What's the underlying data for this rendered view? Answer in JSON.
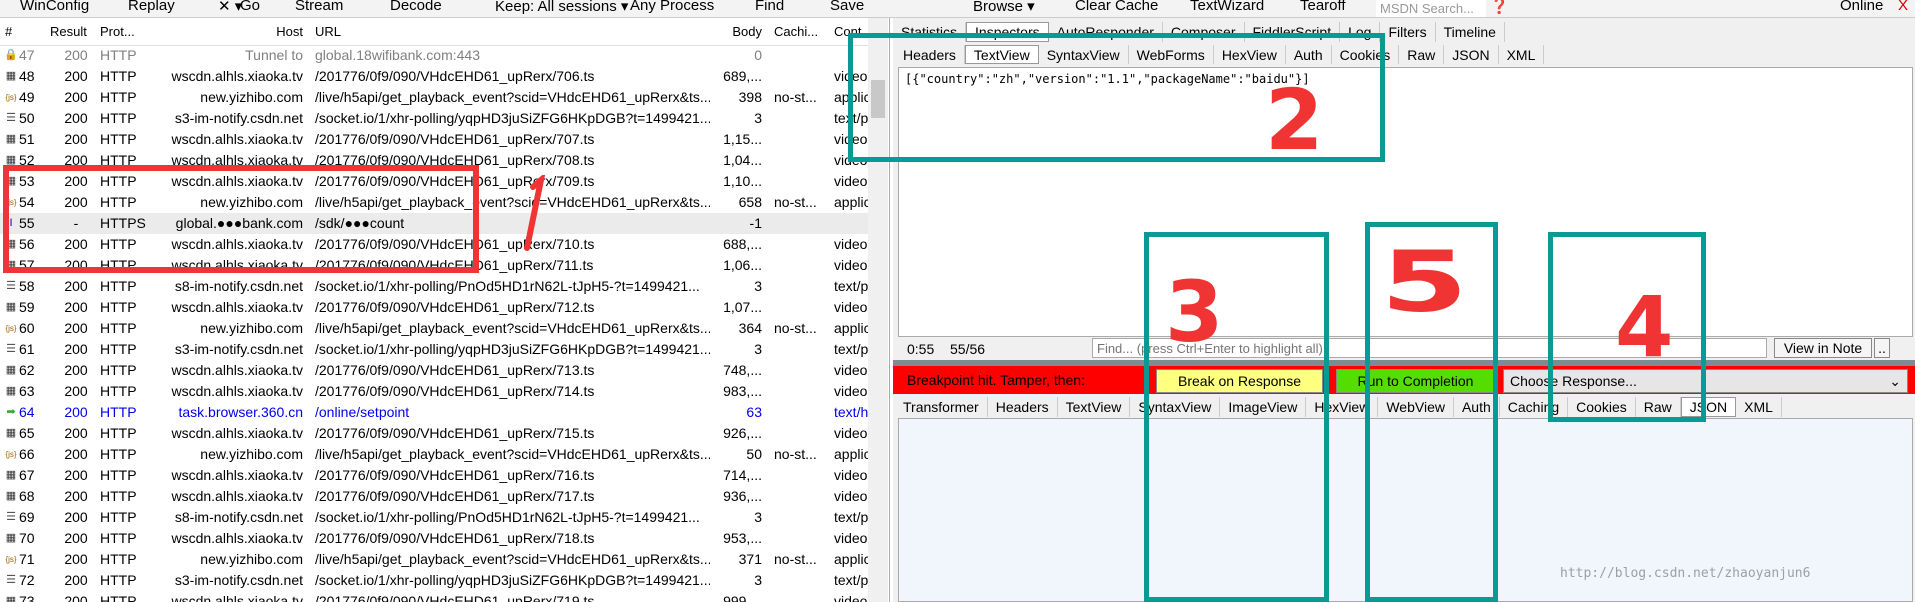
{
  "toolbar": {
    "left": [
      "WinConfig",
      "Replay",
      "✕ ▾",
      "Go",
      "Stream",
      "Decode",
      "Keep: All sessions ▾",
      "Any Process",
      "Find",
      "Save"
    ],
    "right": [
      "Browse ▾",
      "Clear Cache",
      "TextWizard",
      "Tearoff"
    ],
    "search_placeholder": "MSDN Search...",
    "online": "Online",
    "close": "X"
  },
  "columns": {
    "num": "#",
    "result": "Result",
    "protocol": "Prot...",
    "host": "Host",
    "url": "URL",
    "body": "Body",
    "caching": "Cachi...",
    "content": "Cont..."
  },
  "sessions": [
    {
      "icon": "lock-icon",
      "n": "47",
      "r": "200",
      "p": "HTTP",
      "h": "Tunnel to",
      "u": "global.18wifibank.com:443",
      "b": "0",
      "c": "",
      "t": "",
      "style": "dim"
    },
    {
      "icon": "video-icon",
      "n": "48",
      "r": "200",
      "p": "HTTP",
      "h": "wscdn.alhls.xiaoka.tv",
      "u": "/201776/0f9/090/VHdcEHD61_upRerx/706.ts",
      "b": "689,...",
      "c": "",
      "t": "video"
    },
    {
      "icon": "json-icon",
      "n": "49",
      "r": "200",
      "p": "HTTP",
      "h": "new.yizhibo.com",
      "u": "/live/h5api/get_playback_event?scid=VHdcEHD61_upRerx&ts...",
      "b": "398",
      "c": "no-st...",
      "t": "applic"
    },
    {
      "icon": "text-icon",
      "n": "50",
      "r": "200",
      "p": "HTTP",
      "h": "s3-im-notify.csdn.net",
      "u": "/socket.io/1/xhr-polling/yqpHD3juSiZFG6HKpDGB?t=1499421...",
      "b": "3",
      "c": "",
      "t": "text/p"
    },
    {
      "icon": "video-icon",
      "n": "51",
      "r": "200",
      "p": "HTTP",
      "h": "wscdn.alhls.xiaoka.tv",
      "u": "/201776/0f9/090/VHdcEHD61_upRerx/707.ts",
      "b": "1,15...",
      "c": "",
      "t": "video"
    },
    {
      "icon": "video-icon",
      "n": "52",
      "r": "200",
      "p": "HTTP",
      "h": "wscdn.alhls.xiaoka.tv",
      "u": "/201776/0f9/090/VHdcEHD61_upRerx/708.ts",
      "b": "1,04...",
      "c": "",
      "t": "video"
    },
    {
      "icon": "video-icon",
      "n": "53",
      "r": "200",
      "p": "HTTP",
      "h": "wscdn.alhls.xiaoka.tv",
      "u": "/201776/0f9/090/VHdcEHD61_upRerx/709.ts",
      "b": "1,10...",
      "c": "",
      "t": "video"
    },
    {
      "icon": "json-icon",
      "n": "54",
      "r": "200",
      "p": "HTTP",
      "h": "new.yizhibo.com",
      "u": "/live/h5api/get_playback_event?scid=VHdcEHD61_upRerx&ts...",
      "b": "658",
      "c": "no-st...",
      "t": "applic"
    },
    {
      "icon": "breakpoint-icon",
      "n": "55",
      "r": "-",
      "p": "HTTPS",
      "h": "global.●●●bank.com",
      "u": "/sdk/●●●count",
      "b": "-1",
      "c": "",
      "t": "",
      "style": "sel"
    },
    {
      "icon": "video-icon",
      "n": "56",
      "r": "200",
      "p": "HTTP",
      "h": "wscdn.alhls.xiaoka.tv",
      "u": "/201776/0f9/090/VHdcEHD61_upRerx/710.ts",
      "b": "688,...",
      "c": "",
      "t": "video"
    },
    {
      "icon": "video-icon",
      "n": "57",
      "r": "200",
      "p": "HTTP",
      "h": "wscdn.alhls.xiaoka.tv",
      "u": "/201776/0f9/090/VHdcEHD61_upRerx/711.ts",
      "b": "1,06...",
      "c": "",
      "t": "video"
    },
    {
      "icon": "text-icon",
      "n": "58",
      "r": "200",
      "p": "HTTP",
      "h": "s8-im-notify.csdn.net",
      "u": "/socket.io/1/xhr-polling/PnOd5HD1rN62L-tJpH5-?t=1499421...",
      "b": "3",
      "c": "",
      "t": "text/p"
    },
    {
      "icon": "video-icon",
      "n": "59",
      "r": "200",
      "p": "HTTP",
      "h": "wscdn.alhls.xiaoka.tv",
      "u": "/201776/0f9/090/VHdcEHD61_upRerx/712.ts",
      "b": "1,07...",
      "c": "",
      "t": "video"
    },
    {
      "icon": "json-icon",
      "n": "60",
      "r": "200",
      "p": "HTTP",
      "h": "new.yizhibo.com",
      "u": "/live/h5api/get_playback_event?scid=VHdcEHD61_upRerx&ts...",
      "b": "364",
      "c": "no-st...",
      "t": "applic"
    },
    {
      "icon": "text-icon",
      "n": "61",
      "r": "200",
      "p": "HTTP",
      "h": "s3-im-notify.csdn.net",
      "u": "/socket.io/1/xhr-polling/yqpHD3juSiZFG6HKpDGB?t=1499421...",
      "b": "3",
      "c": "",
      "t": "text/p"
    },
    {
      "icon": "video-icon",
      "n": "62",
      "r": "200",
      "p": "HTTP",
      "h": "wscdn.alhls.xiaoka.tv",
      "u": "/201776/0f9/090/VHdcEHD61_upRerx/713.ts",
      "b": "748,...",
      "c": "",
      "t": "video"
    },
    {
      "icon": "video-icon",
      "n": "63",
      "r": "200",
      "p": "HTTP",
      "h": "wscdn.alhls.xiaoka.tv",
      "u": "/201776/0f9/090/VHdcEHD61_upRerx/714.ts",
      "b": "983,...",
      "c": "",
      "t": "video"
    },
    {
      "icon": "arrow-icon",
      "n": "64",
      "r": "200",
      "p": "HTTP",
      "h": "task.browser.360.cn",
      "u": "/online/setpoint",
      "b": "63",
      "c": "",
      "t": "text/h",
      "style": "blue"
    },
    {
      "icon": "video-icon",
      "n": "65",
      "r": "200",
      "p": "HTTP",
      "h": "wscdn.alhls.xiaoka.tv",
      "u": "/201776/0f9/090/VHdcEHD61_upRerx/715.ts",
      "b": "926,...",
      "c": "",
      "t": "video"
    },
    {
      "icon": "json-icon",
      "n": "66",
      "r": "200",
      "p": "HTTP",
      "h": "new.yizhibo.com",
      "u": "/live/h5api/get_playback_event?scid=VHdcEHD61_upRerx&ts...",
      "b": "50",
      "c": "no-st...",
      "t": "applic"
    },
    {
      "icon": "video-icon",
      "n": "67",
      "r": "200",
      "p": "HTTP",
      "h": "wscdn.alhls.xiaoka.tv",
      "u": "/201776/0f9/090/VHdcEHD61_upRerx/716.ts",
      "b": "714,...",
      "c": "",
      "t": "video"
    },
    {
      "icon": "video-icon",
      "n": "68",
      "r": "200",
      "p": "HTTP",
      "h": "wscdn.alhls.xiaoka.tv",
      "u": "/201776/0f9/090/VHdcEHD61_upRerx/717.ts",
      "b": "936,...",
      "c": "",
      "t": "video"
    },
    {
      "icon": "text-icon",
      "n": "69",
      "r": "200",
      "p": "HTTP",
      "h": "s8-im-notify.csdn.net",
      "u": "/socket.io/1/xhr-polling/PnOd5HD1rN62L-tJpH5-?t=1499421...",
      "b": "3",
      "c": "",
      "t": "text/p"
    },
    {
      "icon": "video-icon",
      "n": "70",
      "r": "200",
      "p": "HTTP",
      "h": "wscdn.alhls.xiaoka.tv",
      "u": "/201776/0f9/090/VHdcEHD61_upRerx/718.ts",
      "b": "953,...",
      "c": "",
      "t": "video"
    },
    {
      "icon": "json-icon",
      "n": "71",
      "r": "200",
      "p": "HTTP",
      "h": "new.yizhibo.com",
      "u": "/live/h5api/get_playback_event?scid=VHdcEHD61_upRerx&ts...",
      "b": "371",
      "c": "no-st...",
      "t": "applic"
    },
    {
      "icon": "text-icon",
      "n": "72",
      "r": "200",
      "p": "HTTP",
      "h": "s3-im-notify.csdn.net",
      "u": "/socket.io/1/xhr-polling/yqpHD3juSiZFG6HKpDGB?t=1499421...",
      "b": "3",
      "c": "",
      "t": "text/p"
    },
    {
      "icon": "video-icon",
      "n": "73",
      "r": "200",
      "p": "HTTP",
      "h": "wscdn.alhls.xiaoka.tv",
      "u": "/201776/0f9/090/VHdcEHD61_upRerx/719.ts",
      "b": "999,...",
      "c": "",
      "t": "video"
    }
  ],
  "main_tabs": [
    {
      "label": "Statistics"
    },
    {
      "label": "Inspectors",
      "active": true
    },
    {
      "label": "AutoResponder"
    },
    {
      "label": "Composer"
    },
    {
      "label": "FiddlerScript"
    },
    {
      "label": "Log"
    },
    {
      "label": "Filters"
    },
    {
      "label": "Timeline"
    }
  ],
  "request_tabs": [
    {
      "label": "Headers"
    },
    {
      "label": "TextView",
      "active": true
    },
    {
      "label": "SyntaxView"
    },
    {
      "label": "WebForms"
    },
    {
      "label": "HexView"
    },
    {
      "label": "Auth"
    },
    {
      "label": "Cookies"
    },
    {
      "label": "Raw"
    },
    {
      "label": "JSON"
    },
    {
      "label": "XML"
    }
  ],
  "request_body": "[{\"country\":\"zh\",\"version\":\"1.1\",\"packageName\":\"baidu\"}]",
  "status": {
    "position": "0:55",
    "count": "55/56",
    "find_placeholder": "Find... (press Ctrl+Enter to highlight all)",
    "view_in_notepad": "View in Note",
    "more": ".."
  },
  "breakpoint": {
    "message": "Breakpoint hit. Tamper, then:",
    "break_on_response": "Break on Response",
    "run_to_completion": "Run to Completion",
    "choose_response": "Choose Response...",
    "colors": {
      "bar": "#ff0000",
      "break": "#ffff80",
      "run": "#55dd00"
    }
  },
  "response_tabs": [
    {
      "label": "Transformer"
    },
    {
      "label": "Headers"
    },
    {
      "label": "TextView"
    },
    {
      "label": "SyntaxView"
    },
    {
      "label": "ImageView"
    },
    {
      "label": "HexView"
    },
    {
      "label": "WebView"
    },
    {
      "label": "Auth"
    },
    {
      "label": "Caching"
    },
    {
      "label": "Cookies"
    },
    {
      "label": "Raw"
    },
    {
      "label": "JSON",
      "active": true
    },
    {
      "label": "XML"
    }
  ],
  "annotations": {
    "one": "1",
    "two": "2",
    "three": "3",
    "five": "5",
    "four": "4",
    "colors": {
      "red": "#f03434",
      "teal": "#0a9a94"
    }
  },
  "watermark": "http://blog.csdn.net/zhaoyanjun6"
}
